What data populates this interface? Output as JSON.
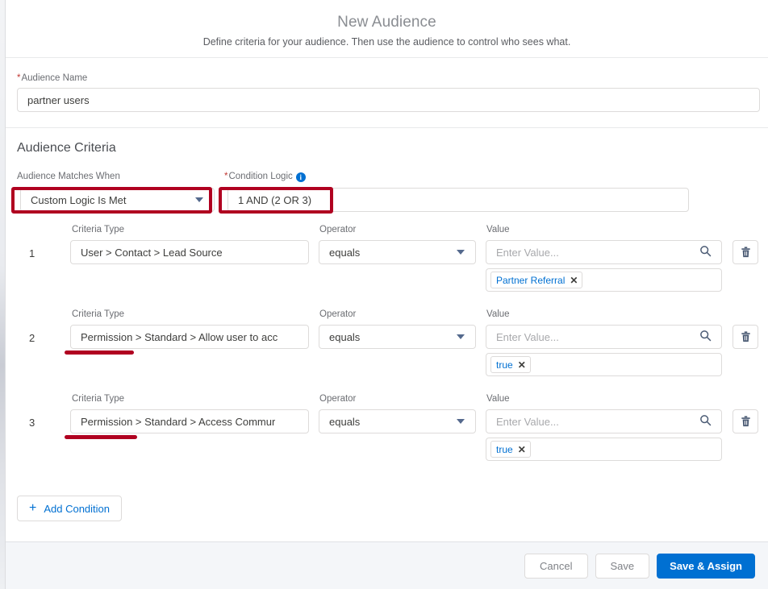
{
  "header": {
    "title": "New Audience",
    "subtitle": "Define criteria for your audience. Then use the audience to control who sees what."
  },
  "name_section": {
    "label": "Audience Name",
    "required_marker": "*",
    "value": "partner users"
  },
  "criteria_section": {
    "title": "Audience Criteria",
    "matches_when": {
      "label": "Audience Matches When",
      "value": "Custom Logic Is Met",
      "chevron_icon": "chevron-down-icon"
    },
    "condition_logic": {
      "label": "Condition Logic",
      "required_marker": "*",
      "info_icon": "info-icon",
      "info_glyph": "i",
      "value": "1 AND (2 OR 3)"
    },
    "column_headers": {
      "criteria_type": "Criteria Type",
      "operator": "Operator",
      "value": "Value"
    },
    "value_placeholder": "Enter Value...",
    "search_icon": "search-icon",
    "delete_icon": "trash-icon",
    "pill_remove_icon": "close-icon",
    "pill_remove_glyph": "✕",
    "rows": [
      {
        "number": "1",
        "criteria_type": "User > Contact > Lead Source",
        "operator": "equals",
        "value_placeholder": "Enter Value...",
        "pill": "Partner Referral"
      },
      {
        "number": "2",
        "criteria_type": "Permission > Standard > Allow user to acc",
        "operator": "equals",
        "value_placeholder": "Enter Value...",
        "pill": "true"
      },
      {
        "number": "3",
        "criteria_type": "Permission > Standard > Access Commur",
        "operator": "equals",
        "value_placeholder": "Enter Value...",
        "pill": "true"
      }
    ],
    "add_condition": {
      "label": "Add Condition",
      "plus_icon": "plus-icon",
      "plus_glyph": "+"
    }
  },
  "footer": {
    "cancel_label": "Cancel",
    "save_label": "Save",
    "save_assign_label": "Save & Assign"
  },
  "colors": {
    "brand_blue": "#0070d2",
    "annotation_red": "#b00020",
    "required_red": "#c23934",
    "footer_bg": "#f4f6f9",
    "border_gray": "#dddbda"
  }
}
